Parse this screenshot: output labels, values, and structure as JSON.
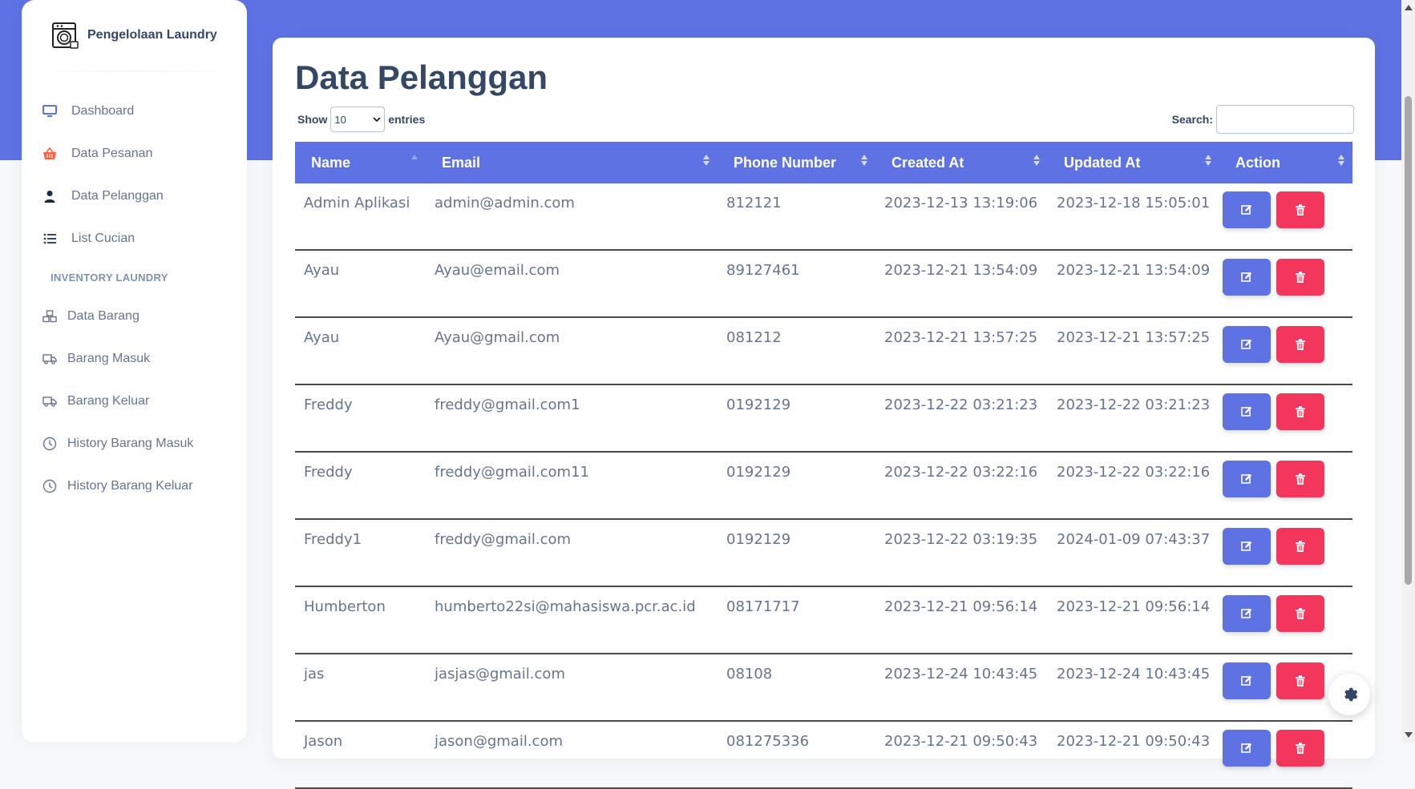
{
  "brand": {
    "title": "Pengelolaan Laundry"
  },
  "sidebar": {
    "items": [
      {
        "label": "Dashboard",
        "icon": "monitor-icon"
      },
      {
        "label": "Data Pesanan",
        "icon": "basket-icon"
      },
      {
        "label": "Data Pelanggan",
        "icon": "user-icon"
      },
      {
        "label": "List Cucian",
        "icon": "list-icon"
      }
    ],
    "section_title": "INVENTORY LAUNDRY",
    "inventory_items": [
      {
        "label": "Data Barang",
        "icon": "boxes-icon"
      },
      {
        "label": "Barang Masuk",
        "icon": "truck-icon"
      },
      {
        "label": "Barang Keluar",
        "icon": "truck-icon"
      },
      {
        "label": "History Barang Masuk",
        "icon": "clock-icon"
      },
      {
        "label": "History Barang Keluar",
        "icon": "clock-icon"
      }
    ]
  },
  "main": {
    "title": "Data Pelanggan",
    "show_label": "Show",
    "entries_value": "10",
    "entries_label": "entries",
    "search_label": "Search:",
    "search_value": ""
  },
  "table": {
    "columns": [
      "Name",
      "Email",
      "Phone Number",
      "Created At",
      "Updated At",
      "Action"
    ],
    "rows": [
      {
        "name": "Admin Aplikasi",
        "email": "admin@admin.com",
        "phone": "812121",
        "created": "2023-12-13 13:19:06",
        "updated": "2023-12-18 15:05:01"
      },
      {
        "name": "Ayau",
        "email": "Ayau@email.com",
        "phone": "89127461",
        "created": "2023-12-21 13:54:09",
        "updated": "2023-12-21 13:54:09"
      },
      {
        "name": "Ayau",
        "email": "Ayau@gmail.com",
        "phone": "081212",
        "created": "2023-12-21 13:57:25",
        "updated": "2023-12-21 13:57:25"
      },
      {
        "name": "Freddy",
        "email": "freddy@gmail.com1",
        "phone": "0192129",
        "created": "2023-12-22 03:21:23",
        "updated": "2023-12-22 03:21:23"
      },
      {
        "name": "Freddy",
        "email": "freddy@gmail.com11",
        "phone": "0192129",
        "created": "2023-12-22 03:22:16",
        "updated": "2023-12-22 03:22:16"
      },
      {
        "name": "Freddy1",
        "email": "freddy@gmail.com",
        "phone": "0192129",
        "created": "2023-12-22 03:19:35",
        "updated": "2024-01-09 07:43:37"
      },
      {
        "name": "Humberton",
        "email": "humberto22si@mahasiswa.pcr.ac.id",
        "phone": "08171717",
        "created": "2023-12-21 09:56:14",
        "updated": "2023-12-21 09:56:14"
      },
      {
        "name": "jas",
        "email": "jasjas@gmail.com",
        "phone": "08108",
        "created": "2023-12-24 10:43:45",
        "updated": "2023-12-24 10:43:45"
      },
      {
        "name": "Jason",
        "email": "jason@gmail.com",
        "phone": "081275336",
        "created": "2023-12-21 09:50:43",
        "updated": "2023-12-21 09:50:43"
      }
    ]
  },
  "colors": {
    "primary": "#5e72e4",
    "danger": "#f5365c",
    "text": "#344767",
    "muted": "#67748e"
  }
}
